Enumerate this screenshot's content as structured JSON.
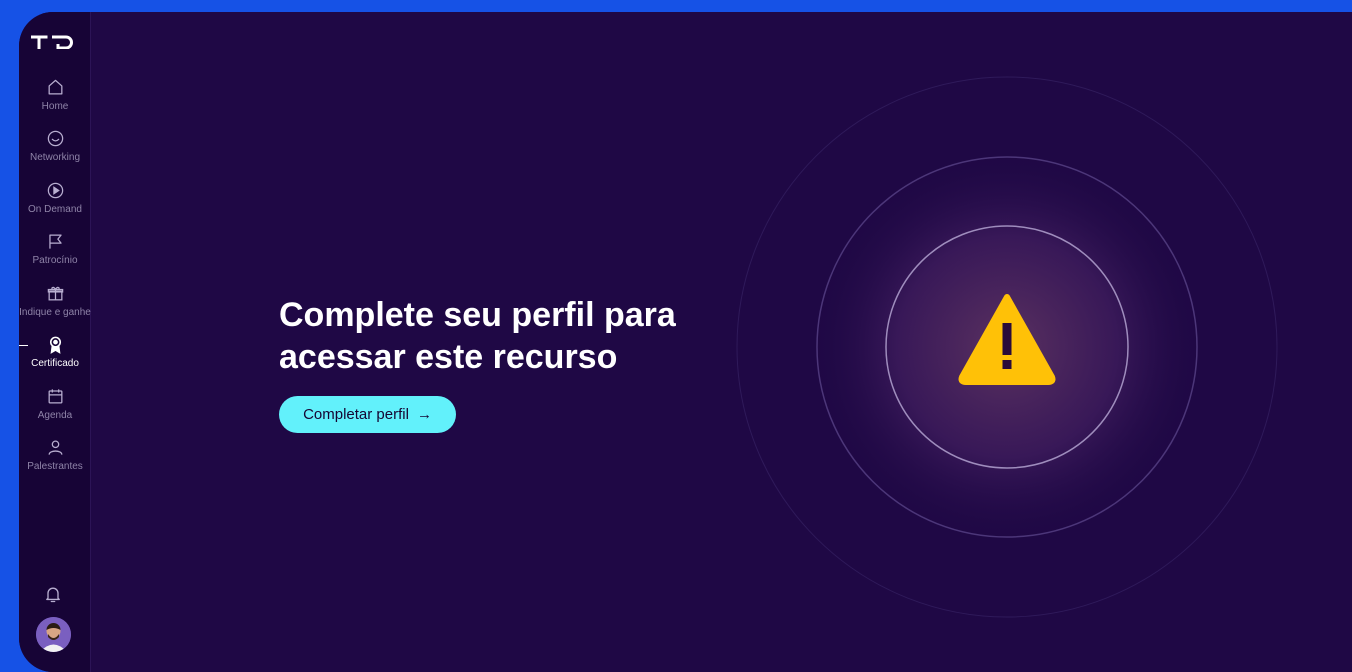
{
  "sidebar": {
    "logo_alt": "TD",
    "items": [
      {
        "label": "Home",
        "icon": "home-icon"
      },
      {
        "label": "Networking",
        "icon": "smile-icon"
      },
      {
        "label": "On Demand",
        "icon": "play-circle-icon"
      },
      {
        "label": "Patrocínio",
        "icon": "flag-icon"
      },
      {
        "label": "Indique e ganhe",
        "icon": "gift-icon"
      },
      {
        "label": "Certificado",
        "icon": "award-icon"
      },
      {
        "label": "Agenda",
        "icon": "calendar-icon"
      },
      {
        "label": "Palestrantes",
        "icon": "user-icon"
      }
    ],
    "active_item": "Certificado",
    "notifications_icon": "bell-icon",
    "avatar_icon": "user-avatar"
  },
  "main": {
    "headline": "Complete seu perfil para acessar este recurso",
    "cta_label": "Completar perfil",
    "cta_icon": "arrow-right-icon",
    "illustration_icon": "warning-triangle-icon"
  },
  "colors": {
    "page_border": "#1652e6",
    "background": "#1f0845",
    "sidebar": "#170436",
    "accent": "#62f1fb",
    "warning": "#ffc107"
  }
}
